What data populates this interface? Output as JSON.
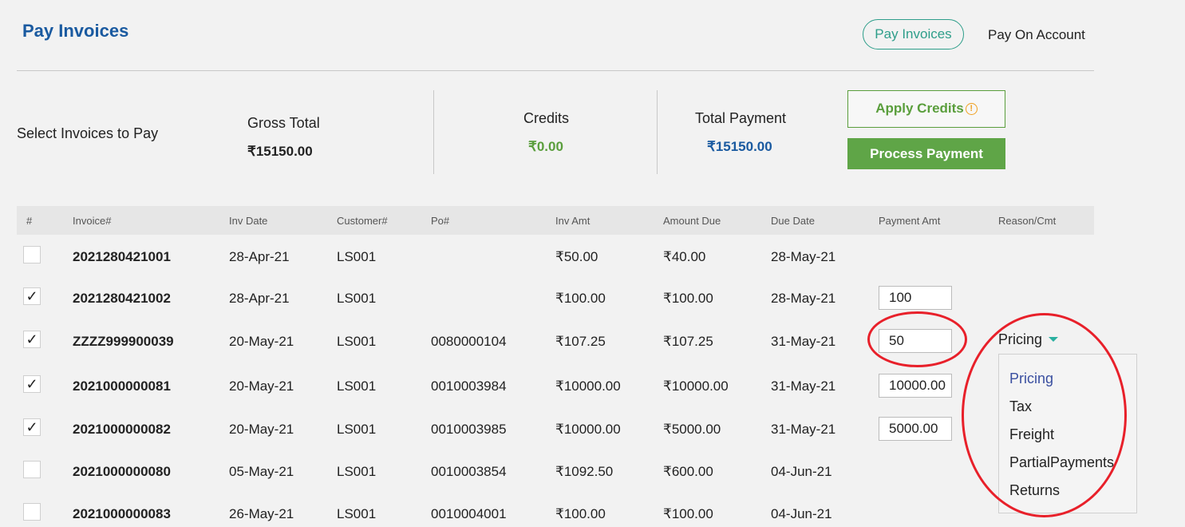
{
  "header": {
    "title": "Pay Invoices",
    "tabs": [
      {
        "label": "Pay Invoices",
        "active": true
      },
      {
        "label": "Pay On Account",
        "active": false
      }
    ]
  },
  "summary": {
    "select_label": "Select Invoices to Pay",
    "gross_total_label": "Gross Total",
    "gross_total_value": "₹15150.00",
    "credits_label": "Credits",
    "credits_value": "₹0.00",
    "total_payment_label": "Total Payment",
    "total_payment_value": "₹15150.00",
    "apply_credits_label": "Apply Credits",
    "process_payment_label": "Process Payment"
  },
  "table": {
    "headers": [
      "#",
      "Invoice#",
      "Inv Date",
      "Customer#",
      "Po#",
      "Inv Amt",
      "Amount Due",
      "Due Date",
      "Payment Amt",
      "Reason/Cmt"
    ],
    "rows": [
      {
        "checked": false,
        "mark": "",
        "invoice": "2021280421001",
        "inv_date": "28-Apr-21",
        "customer": "LS001",
        "po": "",
        "inv_amt": "₹50.00",
        "amount_due": "₹40.00",
        "due_date": "28-May-21",
        "payment_amt": "",
        "reason": ""
      },
      {
        "checked": true,
        "mark": "✓",
        "invoice": "2021280421002",
        "inv_date": "28-Apr-21",
        "customer": "LS001",
        "po": "",
        "inv_amt": "₹100.00",
        "amount_due": "₹100.00",
        "due_date": "28-May-21",
        "payment_amt": "100",
        "reason": ""
      },
      {
        "checked": true,
        "mark": "✓",
        "invoice": "ZZZZ999900039",
        "inv_date": "20-May-21",
        "customer": "LS001",
        "po": "0080000104",
        "inv_amt": "₹107.25",
        "amount_due": "₹107.25",
        "due_date": "31-May-21",
        "payment_amt": "50",
        "reason": "Pricing"
      },
      {
        "checked": true,
        "mark": "✓",
        "invoice": "2021000000081",
        "inv_date": "20-May-21",
        "customer": "LS001",
        "po": "0010003984",
        "inv_amt": "₹10000.00",
        "amount_due": "₹10000.00",
        "due_date": "31-May-21",
        "payment_amt": "10000.00",
        "reason": ""
      },
      {
        "checked": true,
        "mark": "✓",
        "invoice": "2021000000082",
        "inv_date": "20-May-21",
        "customer": "LS001",
        "po": "0010003985",
        "inv_amt": "₹10000.00",
        "amount_due": "₹5000.00",
        "due_date": "31-May-21",
        "payment_amt": "5000.00",
        "reason": ""
      },
      {
        "checked": false,
        "mark": "",
        "invoice": "2021000000080",
        "inv_date": "05-May-21",
        "customer": "LS001",
        "po": "0010003854",
        "inv_amt": "₹1092.50",
        "amount_due": "₹600.00",
        "due_date": "04-Jun-21",
        "payment_amt": "",
        "reason": ""
      },
      {
        "checked": false,
        "mark": "",
        "invoice": "2021000000083",
        "inv_date": "26-May-21",
        "customer": "LS001",
        "po": "0010004001",
        "inv_amt": "₹100.00",
        "amount_due": "₹100.00",
        "due_date": "04-Jun-21",
        "payment_amt": "",
        "reason": ""
      }
    ]
  },
  "reason_dropdown": {
    "selected": "Pricing",
    "options": [
      "Pricing",
      "Tax",
      "Freight",
      "PartialPayments",
      "Returns"
    ]
  },
  "colors": {
    "title": "#1a5aa0",
    "accent_teal": "#2e9e8a",
    "green": "#5fa547",
    "credits_green": "#5a9e3c",
    "total_blue": "#1a5aa0",
    "annotation_red": "#e8202a"
  },
  "icons": {
    "apply_credits_icon": "warning-circle-icon",
    "reason_caret": "caret-down-icon",
    "checkbox_mark": "checkmark-icon"
  }
}
